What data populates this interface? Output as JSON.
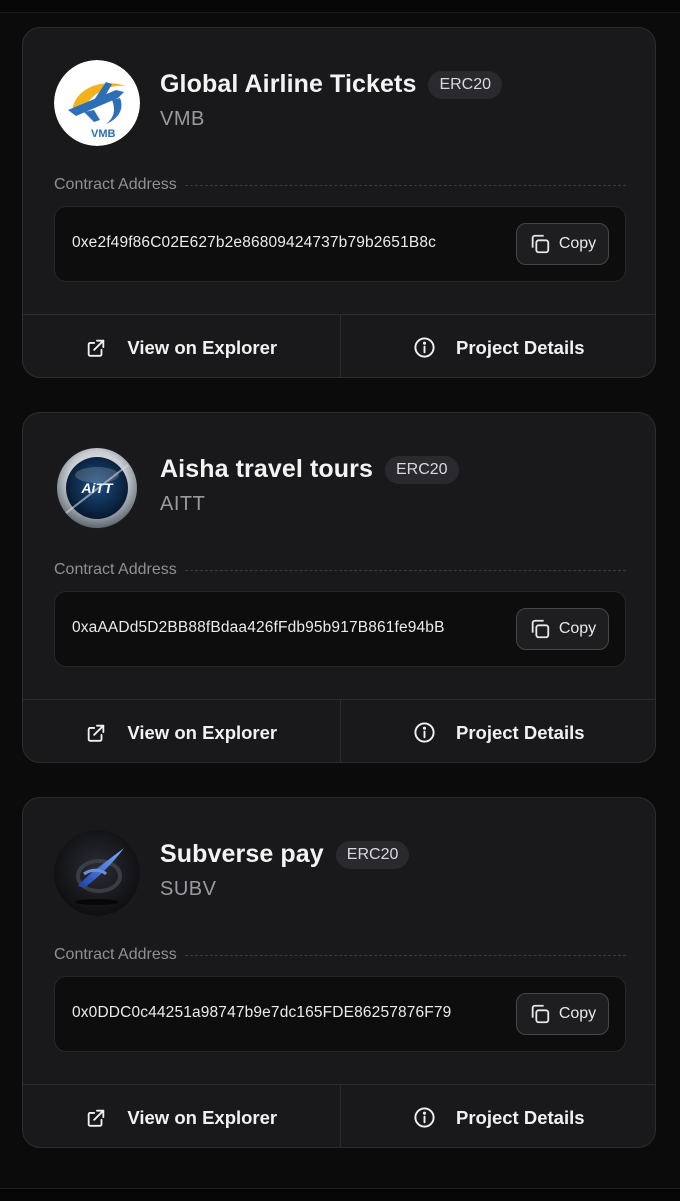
{
  "tokens": [
    {
      "name": "Global Airline Tickets",
      "standard": "ERC20",
      "symbol": "VMB",
      "logo_text": "VMB",
      "contract_label": "Contract Address",
      "address": "0xe2f49f86C02E627b2e86809424737b79b2651B8c",
      "copy_label": "Copy",
      "explorer_label": "View on Explorer",
      "details_label": "Project Details"
    },
    {
      "name": "Aisha travel tours",
      "standard": "ERC20",
      "symbol": "AITT",
      "logo_text": "AiTT",
      "contract_label": "Contract Address",
      "address": "0xaAADd5D2BB88fBdaa426fFdb95b917B861fe94bB",
      "copy_label": "Copy",
      "explorer_label": "View on Explorer",
      "details_label": "Project Details"
    },
    {
      "name": "Subverse pay",
      "standard": "ERC20",
      "symbol": "SUBV",
      "contract_label": "Contract Address",
      "address": "0x0DDC0c44251a98747b9e7dc165FDE86257876F79",
      "copy_label": "Copy",
      "explorer_label": "View on Explorer",
      "details_label": "Project Details"
    }
  ],
  "icons": {
    "copy": "copy-icon",
    "explorer": "external-link-icon",
    "details": "info-circle-icon"
  },
  "colors": {
    "background": "#0b0b0c",
    "card": "#19191b",
    "address_box": "#0d0d0e",
    "text": "#f2f2f3",
    "muted": "#9a9aa0"
  }
}
